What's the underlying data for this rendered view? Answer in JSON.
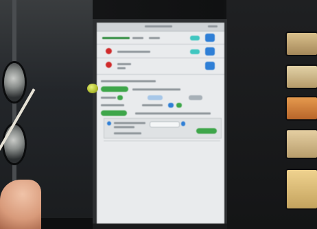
{
  "scene": {
    "description_name": "photo-of-touchscreen-demo",
    "colors": {
      "screen": "#e9ebed",
      "accent_blue": "#2f7fd6",
      "accent_teal": "#3fc6c0",
      "accent_green": "#3ea64a",
      "logo_red": "#d02a2a",
      "ball_yellow": "#c8d23a"
    }
  },
  "screen_ui": {
    "row_icons": [
      "logo-red",
      "logo-red",
      "logo-red"
    ],
    "toggles": [
      "on",
      "on",
      "on"
    ]
  }
}
